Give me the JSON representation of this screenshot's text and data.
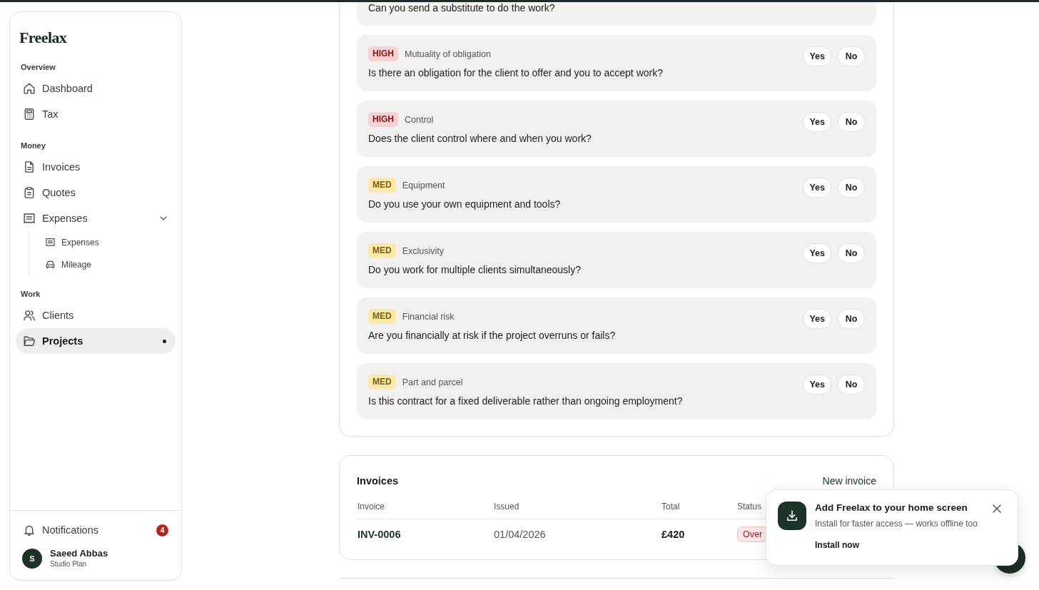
{
  "sidebar": {
    "logo": "Freelax",
    "sections": [
      {
        "label": "Overview",
        "items": [
          {
            "label": "Dashboard",
            "selected": false
          },
          {
            "label": "Tax",
            "selected": false
          }
        ]
      },
      {
        "label": "Money",
        "items": [
          {
            "label": "Invoices",
            "selected": false
          },
          {
            "label": "Quotes",
            "selected": false
          },
          {
            "label": "Expenses",
            "selected": false,
            "expanded": true,
            "children": [
              {
                "label": "Expenses",
                "selected": false
              },
              {
                "label": "Mileage",
                "selected": false
              }
            ]
          }
        ]
      },
      {
        "label": "Work",
        "items": [
          {
            "label": "Clients",
            "selected": false
          },
          {
            "label": "Projects",
            "selected": true
          }
        ]
      }
    ],
    "notifications": {
      "label": "Notifications",
      "count": "4"
    },
    "user": {
      "initial": "S",
      "name": "Saeed Abbas",
      "plan": "Studio Plan"
    }
  },
  "questions": [
    {
      "question": "Can you send a substitute to do the work?"
    },
    {
      "badge": {
        "text": "HIGH",
        "color": "#f8d2d2"
      },
      "category": "Mutuality of obligation",
      "question": "Is there an obligation for the client to offer and you to accept work?",
      "answers": [
        {
          "label": "Yes",
          "selected": false
        },
        {
          "label": "No",
          "selected": false
        }
      ]
    },
    {
      "badge": {
        "text": "HIGH",
        "color": "#f8d2d2"
      },
      "category": "Control",
      "question": "Does the client control where and when you work?",
      "answers": [
        {
          "label": "Yes",
          "selected": false
        },
        {
          "label": "No",
          "selected": false
        }
      ]
    },
    {
      "badge": {
        "text": "MED",
        "color": "#fce8a8"
      },
      "category": "Equipment",
      "question": "Do you use your own equipment and tools?",
      "answers": [
        {
          "label": "Yes",
          "selected": false
        },
        {
          "label": "No",
          "selected": false
        }
      ]
    },
    {
      "badge": {
        "text": "MED",
        "color": "#fce8a8"
      },
      "category": "Exclusivity",
      "question": "Do you work for multiple clients simultaneously?",
      "answers": [
        {
          "label": "Yes",
          "selected": false
        },
        {
          "label": "No",
          "selected": false
        }
      ]
    },
    {
      "badge": {
        "text": "MED",
        "color": "#fce8a8"
      },
      "category": "Financial risk",
      "question": "Are you financially at risk if the project overruns or fails?",
      "answers": [
        {
          "label": "Yes",
          "selected": false
        },
        {
          "label": "No",
          "selected": false
        }
      ]
    },
    {
      "badge": {
        "text": "MED",
        "color": "#fce8a8"
      },
      "category": "Part and parcel",
      "question": "Is this contract for a fixed deliverable rather than ongoing employment?",
      "answers": [
        {
          "label": "Yes",
          "selected": false
        },
        {
          "label": "No",
          "selected": false
        }
      ]
    }
  ],
  "invoices": {
    "title": "Invoices",
    "action": "New invoice",
    "columns": [
      "Invoice",
      "Issued",
      "Total",
      "Status"
    ],
    "rows": [
      {
        "invoice": "INV-0006",
        "issued": "01/04/2026",
        "total": "£420",
        "status": "Over"
      }
    ]
  },
  "install_prompt": {
    "title": "Add Freelax to your home screen",
    "message": "Install for faster access — works offline too",
    "action": "Install now"
  }
}
